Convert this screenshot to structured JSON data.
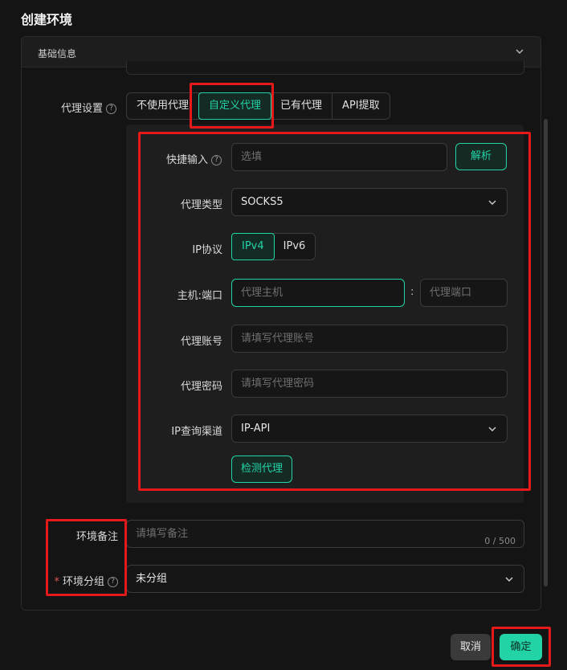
{
  "dialog": {
    "title": "创建环境",
    "section_label": "基础信息"
  },
  "proxy_settings": {
    "label": "代理设置",
    "help": "?",
    "options": [
      "不使用代理",
      "自定义代理",
      "已有代理",
      "API提取"
    ],
    "selected": "自定义代理"
  },
  "proxy_form": {
    "quick_input": {
      "label": "快捷输入",
      "help": "?",
      "placeholder": "选填",
      "parse_button": "解析"
    },
    "proxy_type": {
      "label": "代理类型",
      "value": "SOCKS5"
    },
    "ip_protocol": {
      "label": "IP协议",
      "options": [
        "IPv4",
        "IPv6"
      ],
      "selected": "IPv4"
    },
    "host_port": {
      "label": "主机:端口",
      "host_placeholder": "代理主机",
      "separator": ":",
      "port_placeholder": "代理端口"
    },
    "account": {
      "label": "代理账号",
      "placeholder": "请填写代理账号"
    },
    "password": {
      "label": "代理密码",
      "placeholder": "请填写代理密码"
    },
    "ip_channel": {
      "label": "IP查询渠道",
      "value": "IP-API"
    },
    "check_button": "检测代理"
  },
  "remark": {
    "label": "环境备注",
    "placeholder": "请填写备注",
    "counter": "0 / 500"
  },
  "group": {
    "required_mark": "*",
    "label": "环境分组",
    "help": "?",
    "value": "未分组"
  },
  "footer": {
    "cancel": "取消",
    "confirm": "确定"
  },
  "colors": {
    "accent": "#22d3a6",
    "highlight": "#e41a1a",
    "background": "#141414"
  },
  "icons": {
    "section_toggle": "chevron-down-icon",
    "help": "help-circle-icon",
    "select": "chevron-down-icon"
  }
}
